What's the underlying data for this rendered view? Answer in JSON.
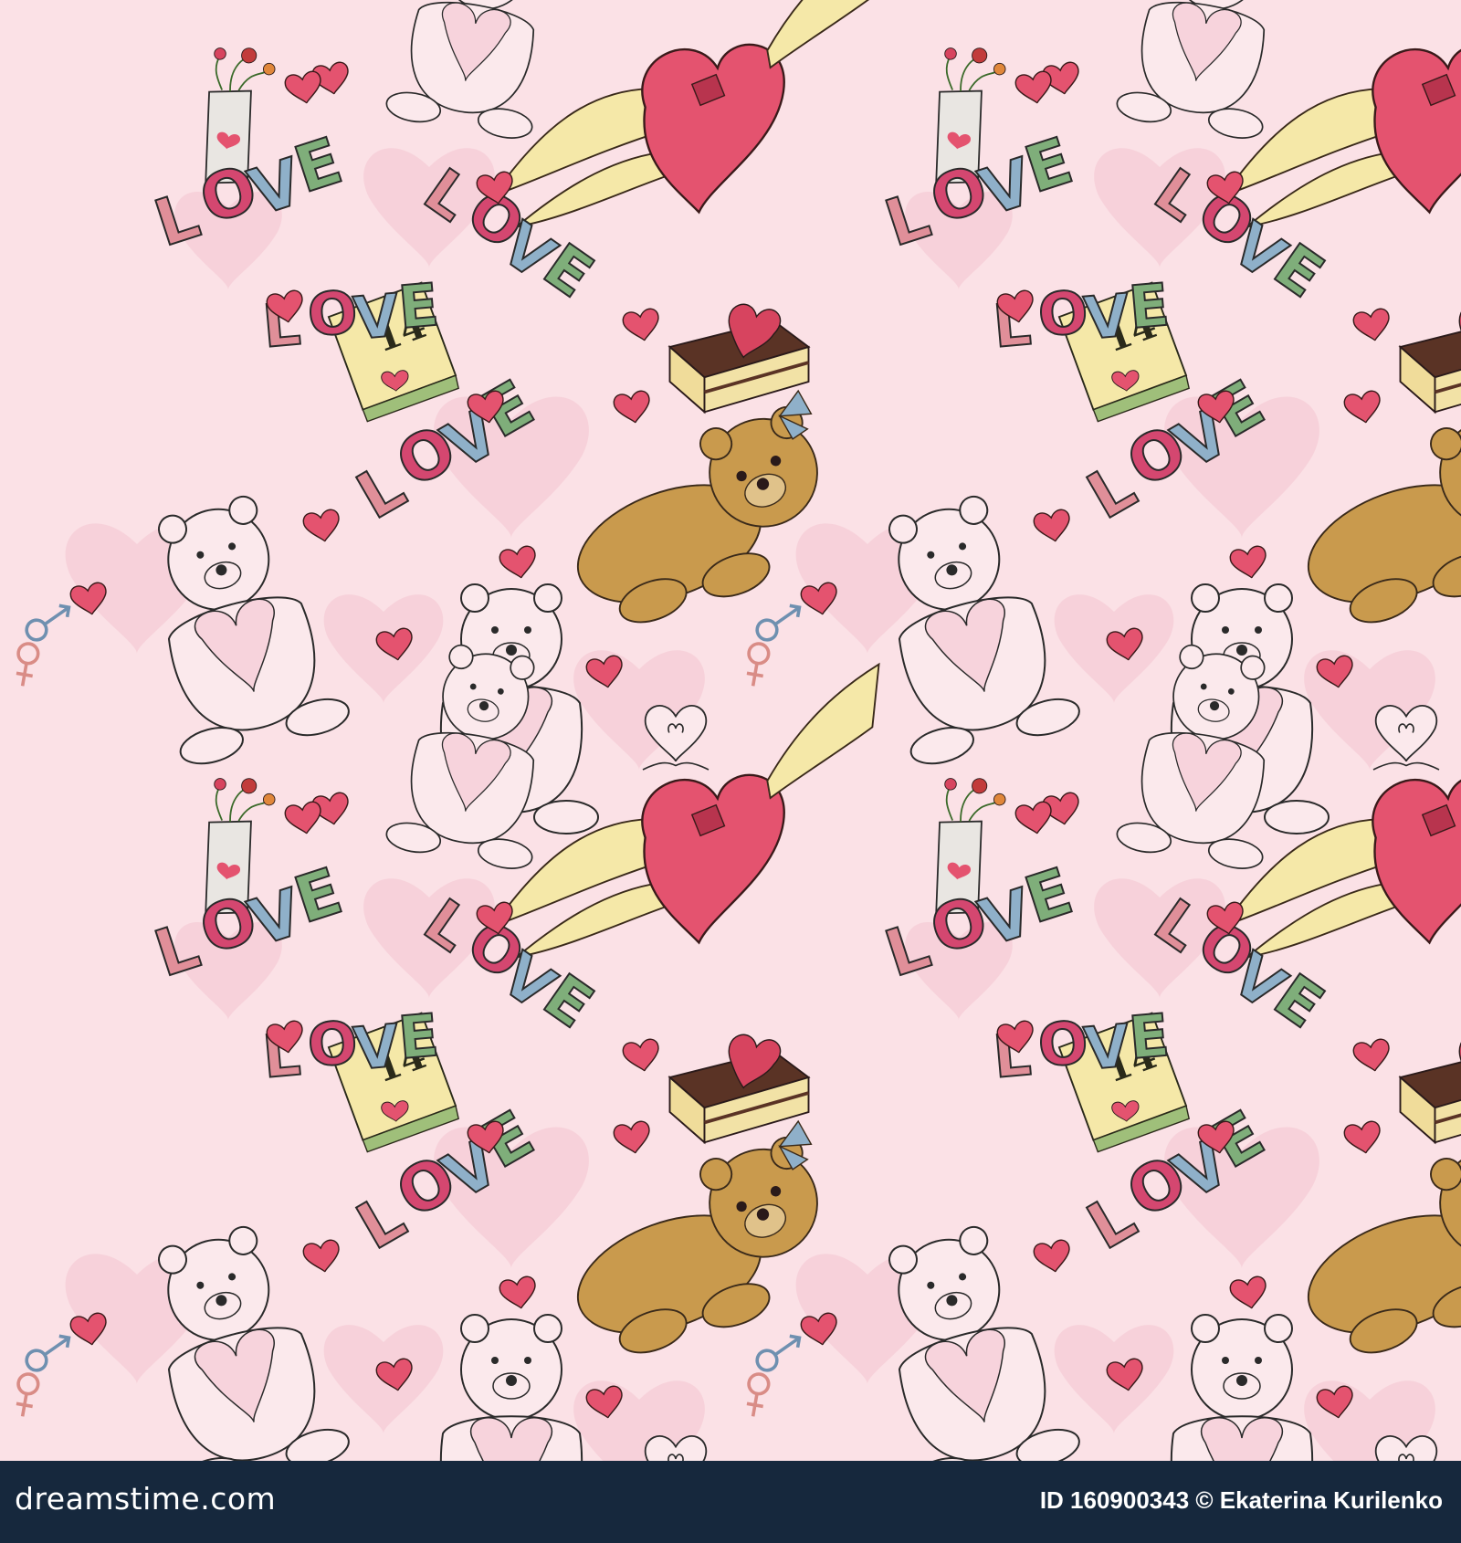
{
  "image": {
    "description_kind": "seamless valentine doodle pattern",
    "colors": {
      "background": "#fbe1e6",
      "heart_red": "#e4536f",
      "bear_tan": "#c99a4d",
      "wing_cream": "#f5e8a8",
      "love_green": "#7fae7a",
      "love_blue": "#8fb0c9",
      "love_pink": "#e08f99",
      "love_magenta": "#d44770",
      "footer_bg": "#16283d"
    },
    "motif_words": [
      "LOVE",
      "14"
    ]
  },
  "footer": {
    "brand": "dreamstime.com",
    "id_text": "ID 160900343 © Ekaterina Kurilenko"
  }
}
